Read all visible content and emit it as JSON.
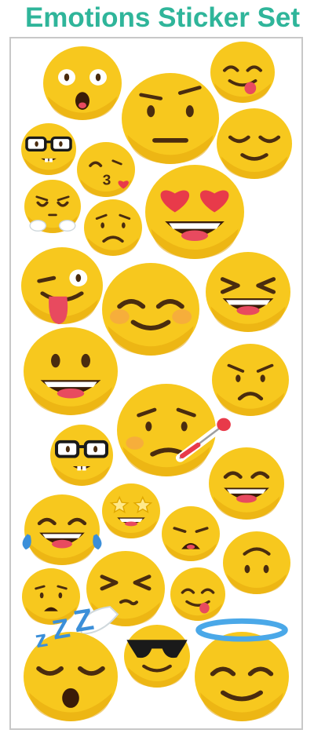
{
  "page": {
    "title": "Emotions Sticker Set",
    "title_color": "#2fb59a",
    "sheet_border_color": "#c8c8c8"
  },
  "palette": {
    "face": "#f7c81e",
    "face_shadow": "#e6a70d",
    "feature": "#4a2c0f",
    "mouth_inner": "#3a1c08",
    "teeth": "#ffffff",
    "tongue": "#e84a5f",
    "heart": "#e83a4a",
    "blush": "#f5a742",
    "tear": "#3b8fd9",
    "zzz": "#3b8fd9",
    "halo": "#4aa8e8",
    "glasses": "#1a1a1a",
    "star": "#ffe98a"
  },
  "stickers": [
    {
      "name": "astonished-face-icon"
    },
    {
      "name": "savoring-tongue-face-icon"
    },
    {
      "name": "raised-eyebrow-face-icon"
    },
    {
      "name": "nerd-face-icon"
    },
    {
      "name": "relieved-face-icon"
    },
    {
      "name": "kissing-heart-face-icon"
    },
    {
      "name": "heart-eyes-face-icon"
    },
    {
      "name": "steam-from-nose-face-icon"
    },
    {
      "name": "worried-face-icon"
    },
    {
      "name": "winking-tongue-face-icon"
    },
    {
      "name": "blushing-smile-face-icon"
    },
    {
      "name": "grinning-squinting-face-icon"
    },
    {
      "name": "grinning-big-eyes-face-icon"
    },
    {
      "name": "angry-face-icon"
    },
    {
      "name": "thermometer-sick-face-icon"
    },
    {
      "name": "nerd-face-small-icon"
    },
    {
      "name": "grinning-smiling-eyes-face-icon"
    },
    {
      "name": "tears-of-joy-face-icon"
    },
    {
      "name": "star-struck-face-icon"
    },
    {
      "name": "weary-face-icon"
    },
    {
      "name": "upside-down-face-icon"
    },
    {
      "name": "frowning-face-icon"
    },
    {
      "name": "exhaling-face-icon"
    },
    {
      "name": "savoring-tongue-small-face-icon"
    },
    {
      "name": "sleeping-face-icon"
    },
    {
      "name": "sunglasses-face-icon"
    },
    {
      "name": "halo-face-icon"
    }
  ]
}
